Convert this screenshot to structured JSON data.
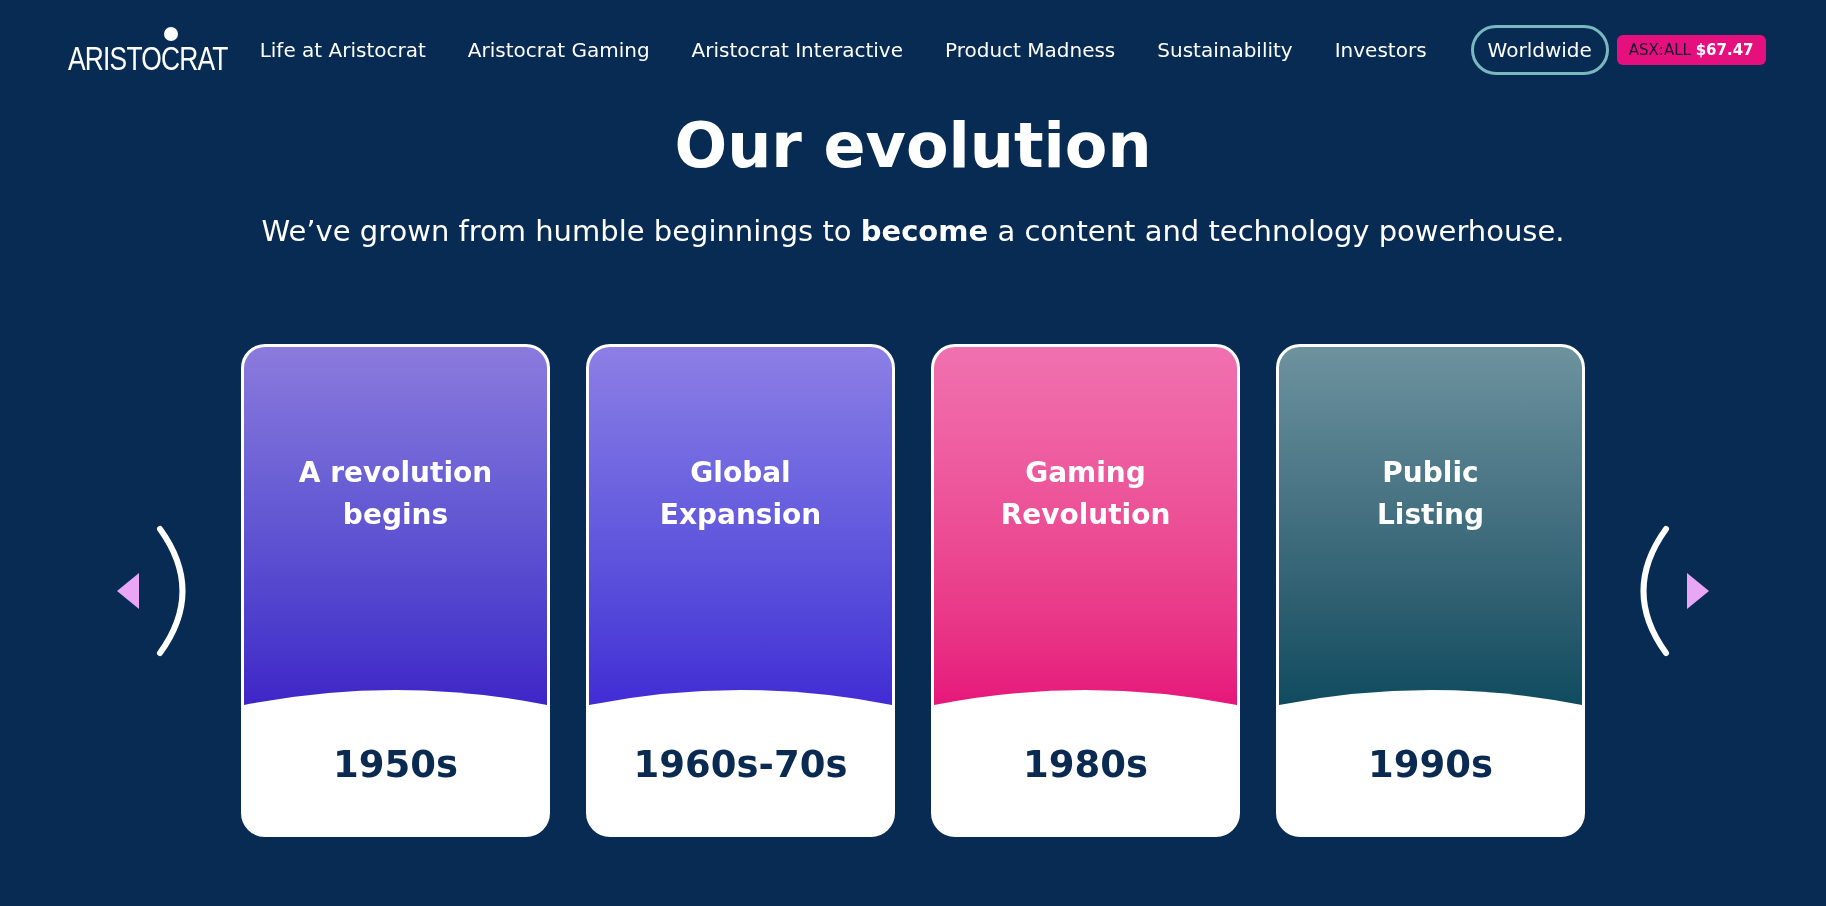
{
  "header": {
    "logo": "ARISTOCRAT",
    "nav": [
      "Life at Aristocrat",
      "Aristocrat Gaming",
      "Aristocrat Interactive",
      "Product Madness",
      "Sustainability",
      "Investors"
    ],
    "region_button": "Worldwide",
    "stock": {
      "ticker": "ASX:ALL",
      "price": "$67.47"
    }
  },
  "section": {
    "title": "Our evolution",
    "subtitle": "We’ve grown from humble beginnings to **become** a content and technology powerhouse.",
    "cards": [
      {
        "title": "A revolution begins",
        "period": "1950s",
        "color": "#3e22c6"
      },
      {
        "title": "Global Expansion",
        "period": "1960s-70s",
        "color": "#4129d4"
      },
      {
        "title": "Gaming Revolution",
        "period": "1980s",
        "color": "#e6127a"
      },
      {
        "title": "Public Listing",
        "period": "1990s",
        "color": "#0c4a5e"
      }
    ]
  }
}
